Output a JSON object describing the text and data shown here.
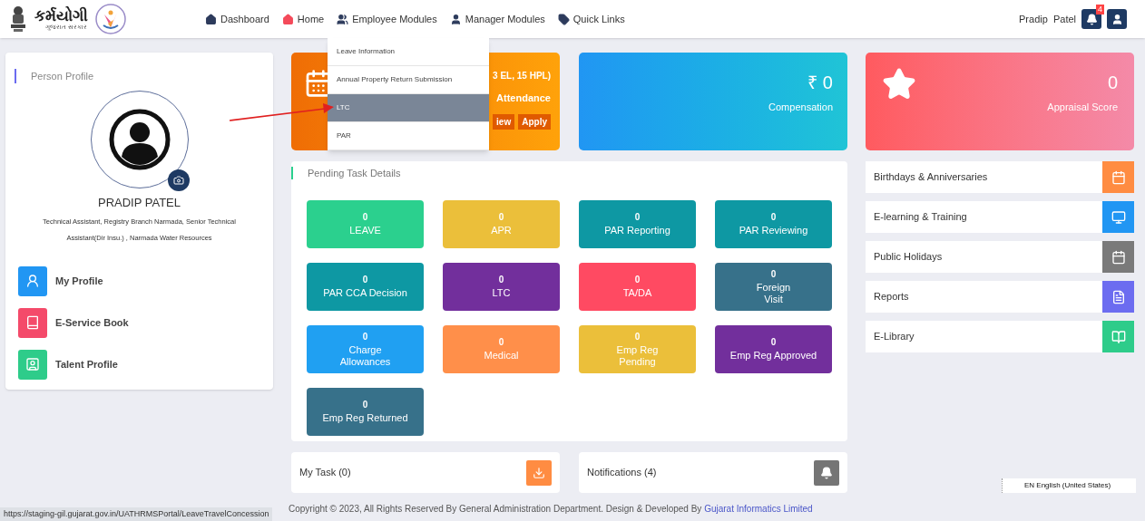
{
  "header": {
    "logo_text": "કર્મયોગી",
    "logo_subtext": "ગુજરાત સરકાર",
    "nav": [
      {
        "kind": "home",
        "label": "Dashboard",
        "selected": false
      },
      {
        "kind": "home",
        "label": "Home",
        "selected": true
      },
      {
        "kind": "users",
        "label": "Employee Modules",
        "selected": false
      },
      {
        "kind": "user",
        "label": "Manager Modules",
        "selected": false
      },
      {
        "kind": "tag",
        "label": "Quick Links",
        "selected": false
      }
    ],
    "user_name": "Pradip  Patel",
    "notification_count": "4"
  },
  "dropdown": {
    "items": [
      {
        "label": "Leave Information",
        "selected": false
      },
      {
        "label": "Annual Property Return Submission",
        "selected": false
      },
      {
        "label": "LTC",
        "selected": true
      },
      {
        "label": "PAR",
        "selected": false
      }
    ]
  },
  "profile": {
    "title": "Person Profile",
    "name": "PRADIP PATEL",
    "designation": "Technical Assistant, Registry Branch Narmada, Senior Technical Assistant(Dir Insu.) , Narmada Water Resources",
    "links": [
      {
        "kind": "user",
        "label": "My Profile",
        "color": "#2196f3"
      },
      {
        "kind": "book",
        "label": "E-Service Book",
        "color": "#f44a6a"
      },
      {
        "kind": "contact",
        "label": "Talent Profile",
        "color": "#2ecc8a"
      }
    ]
  },
  "leave_card": {
    "balance": "3 EL, 15 HPL)",
    "attendance": "Attendance",
    "buttons": [
      "iew",
      "Apply"
    ]
  },
  "compensation_card": {
    "value": "₹ 0",
    "label": "Compensation"
  },
  "appraisal_card": {
    "value": "0",
    "label": "Appraisal Score"
  },
  "pending": {
    "title": "Pending Task Details",
    "tiles": [
      {
        "count": "0",
        "label": "LEAVE",
        "color": "#2bd08e"
      },
      {
        "count": "0",
        "label": "APR",
        "color": "#ebbf3a"
      },
      {
        "count": "0",
        "label": "PAR Reporting",
        "color": "#0e98a3"
      },
      {
        "count": "0",
        "label": "PAR Reviewing",
        "color": "#0e98a3"
      },
      {
        "count": "0",
        "label": "PAR CCA Decision",
        "color": "#0e98a3"
      },
      {
        "count": "0",
        "label": "LTC",
        "color": "#722f9c"
      },
      {
        "count": "0",
        "label": "TA/DA",
        "color": "#ff4a62"
      },
      {
        "count": "0",
        "label": "Foreign\nVisit",
        "color": "#37718a"
      },
      {
        "count": "0",
        "label": "Charge\nAllowances",
        "color": "#20a0f2"
      },
      {
        "count": "0",
        "label": "Medical",
        "color": "#ff8f4a"
      },
      {
        "count": "0",
        "label": "Emp Reg\nPending",
        "color": "#ebbf3a"
      },
      {
        "count": "0",
        "label": "Emp Reg Approved",
        "color": "#722f9c"
      },
      {
        "count": "0",
        "label": "Emp Reg Returned",
        "color": "#37718a"
      }
    ]
  },
  "my_task": {
    "label": "My Task (0)"
  },
  "notifications": {
    "label": "Notifications (4)"
  },
  "side_links": [
    {
      "kind": "calendar",
      "label": "Birthdays & Anniversaries",
      "color": "#ff8c42"
    },
    {
      "kind": "monitor",
      "label": "E-learning & Training",
      "color": "#2196f3"
    },
    {
      "kind": "calendar",
      "label": "Public Holidays",
      "color": "#7a7a7a"
    },
    {
      "kind": "file",
      "label": "Reports",
      "color": "#6c6cf0"
    },
    {
      "kind": "book",
      "label": "E-Library",
      "color": "#2ecc8a"
    }
  ],
  "footer": {
    "text": "Copyright © 2023, All Rights Reserved By General Administration Department. Design & Developed By",
    "link": "Gujarat Informatics Limited"
  },
  "status_url": "https://staging-gil.gujarat.gov.in/UATHRMSPortal/LeaveTravelConcession",
  "language": "EN English (United States)"
}
